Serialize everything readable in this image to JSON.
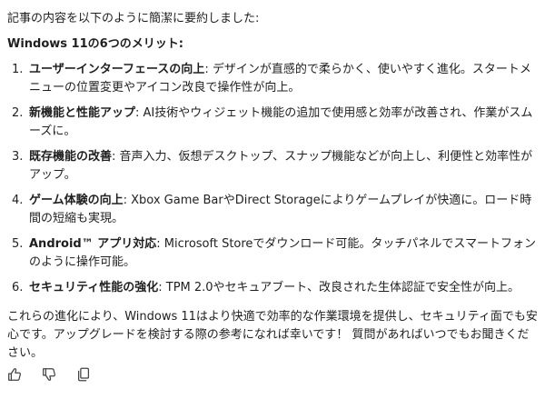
{
  "message": {
    "intro": "記事の内容を以下のように簡潔に要約しました:",
    "heading": "Windows 11の6つのメリット:",
    "items": [
      {
        "num": "1.",
        "title": "ユーザーインターフェースの向上",
        "text": ": デザインが直感的で柔らかく、使いやすく進化。スタートメニューの位置変更やアイコン改良で操作性が向上。"
      },
      {
        "num": "2.",
        "title": "新機能と性能アップ",
        "text": ": AI技術やウィジェット機能の追加で使用感と効率が改善され、作業がスムーズに。"
      },
      {
        "num": "3.",
        "title": "既存機能の改善",
        "text": ": 音声入力、仮想デスクトップ、スナップ機能などが向上し、利便性と効率性がアップ。"
      },
      {
        "num": "4.",
        "title": "ゲーム体験の向上",
        "text": ": Xbox Game BarやDirect Storageによりゲームプレイが快適に。ロード時間の短縮も実現。"
      },
      {
        "num": "5.",
        "title": "Android™ アプリ対応",
        "text": ": Microsoft Storeでダウンロード可能。タッチパネルでスマートフォンのように操作可能。"
      },
      {
        "num": "6.",
        "title": "セキュリティ性能の強化",
        "text": ": TPM 2.0やセキュアブート、改良された生体認証で安全性が向上。"
      }
    ],
    "outro": "これらの進化により、Windows 11はより快適で効率的な作業環境を提供し、セキュリティ面でも安心です。アップグレードを検討する際の参考になれば幸いです！ 質問があればいつでもお聞きください。"
  },
  "actions": {
    "like_icon": "thumbs-up-icon",
    "dislike_icon": "thumbs-down-icon",
    "copy_icon": "copy-icon"
  }
}
